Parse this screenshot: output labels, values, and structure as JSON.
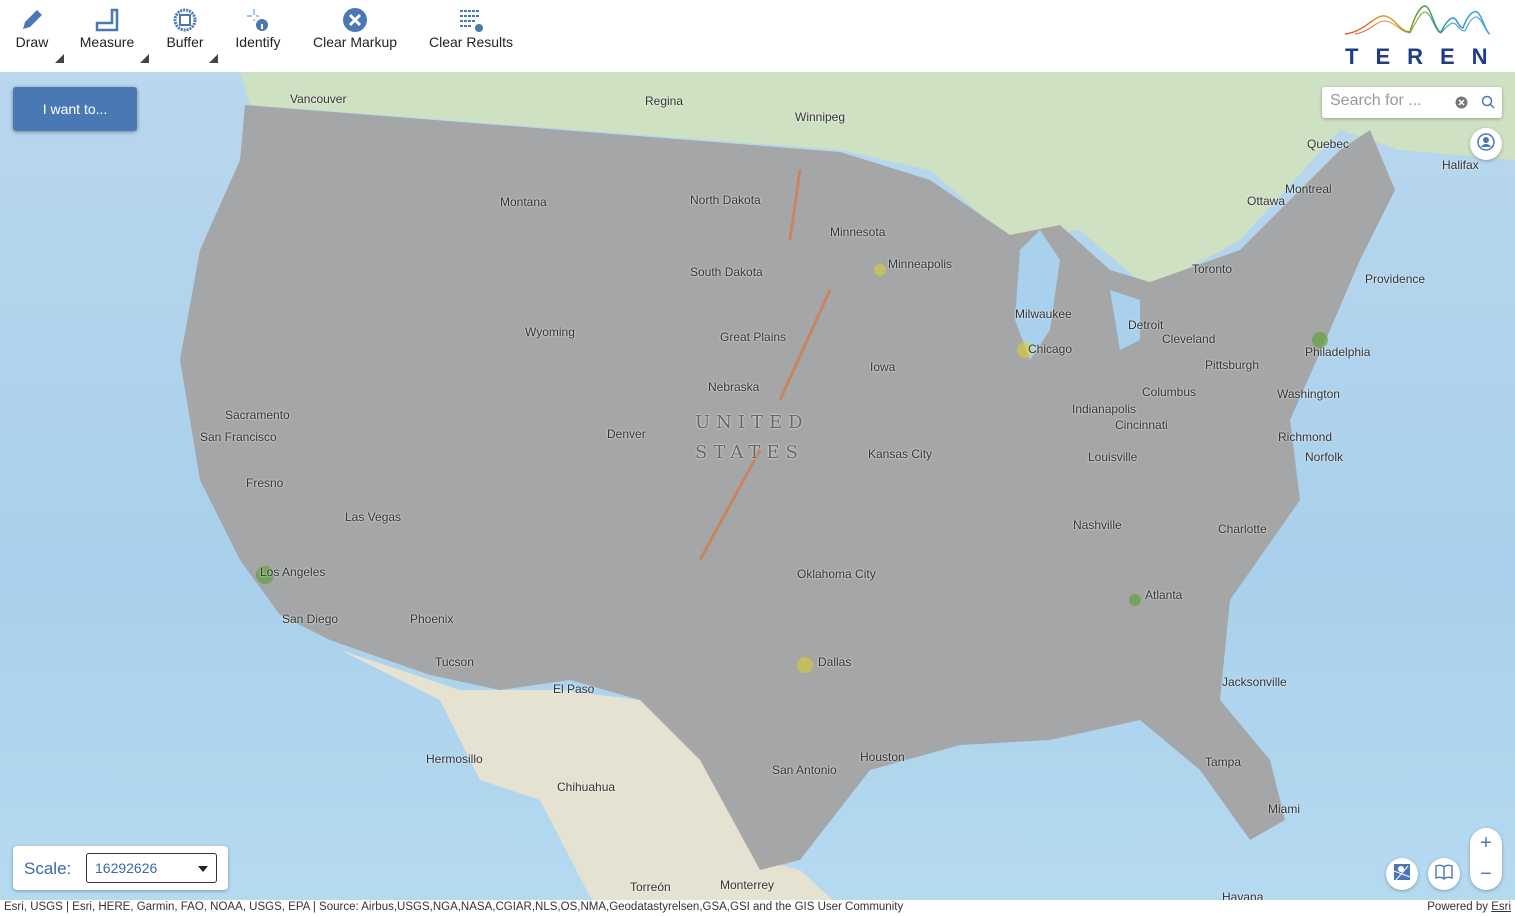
{
  "toolbar": {
    "tools": [
      {
        "label": "Draw",
        "icon": "pencil-icon",
        "has_menu": true
      },
      {
        "label": "Measure",
        "icon": "ruler-icon",
        "has_menu": true
      },
      {
        "label": "Buffer",
        "icon": "buffer-icon",
        "has_menu": true
      },
      {
        "label": "Identify",
        "icon": "identify-icon",
        "has_menu": false
      },
      {
        "label": "Clear Markup",
        "icon": "clear-circle-icon",
        "has_menu": false
      },
      {
        "label": "Clear Results",
        "icon": "clear-list-icon",
        "has_menu": false
      }
    ]
  },
  "logo": {
    "text": "TEREN"
  },
  "iwant": {
    "label": "I want to..."
  },
  "search": {
    "placeholder": "Search for ...",
    "value": ""
  },
  "scale": {
    "label": "Scale:",
    "value": "16292626"
  },
  "zoom": {
    "in": "+",
    "out": "−"
  },
  "attribution": {
    "text": "Esri, USGS | Esri, HERE, Garmin, FAO, NOAA, USGS, EPA | Source: Airbus,USGS,NGA,NASA,CGIAR,NLS,OS,NMA,Geodatastyrelsen,GSA,GSI and the GIS User Community",
    "powered": "Powered by ",
    "esri": "Esri"
  },
  "colors": {
    "accent": "#4a78b5",
    "brand": "#1f3c88",
    "land_overlay": "#a3a3a3"
  },
  "map": {
    "labels": [
      "Vancouver",
      "Regina",
      "Winnipeg",
      "Montana",
      "North Dakota",
      "Minnesota",
      "South Dakota",
      "Wyoming",
      "Great Plains",
      "Nebraska",
      "Iowa",
      "Minneapolis",
      "Milwaukee",
      "Chicago",
      "Detroit",
      "Toronto",
      "Ottawa",
      "Montreal",
      "Quebec",
      "Halifax",
      "Cleveland",
      "Pittsburgh",
      "Philadelphia",
      "Washington",
      "Richmond",
      "Norfolk",
      "Providence",
      "Indianapolis",
      "Columbus",
      "Cincinnati",
      "Louisville",
      "Nashville",
      "Charlotte",
      "Atlanta",
      "Jacksonville",
      "Tampa",
      "Miami",
      "Sacramento",
      "San Francisco",
      "Fresno",
      "Las Vegas",
      "Los Angeles",
      "San Diego",
      "Phoenix",
      "Tucson",
      "El Paso",
      "Denver",
      "Kansas City",
      "Oklahoma City",
      "Dallas",
      "Houston",
      "San Antonio",
      "Hermosillo",
      "Chihuahua",
      "Torreón",
      "Monterrey",
      "Havana",
      "UNITED",
      "STATES"
    ]
  }
}
